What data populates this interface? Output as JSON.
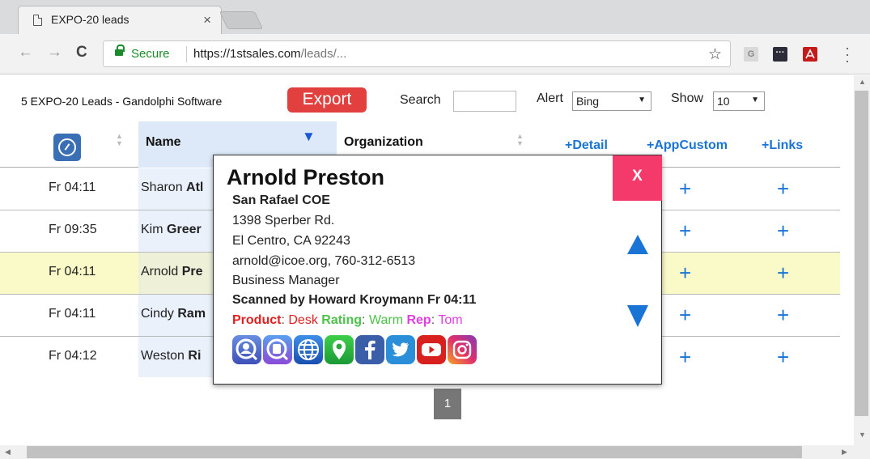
{
  "browser": {
    "tab_title": "EXPO-20 leads",
    "tab_close": "×",
    "secure_label": "Secure",
    "url_main": "https://1stsales.com",
    "url_rest": "/leads/...",
    "back": "←",
    "forward": "→",
    "reload": "C",
    "star": "☆",
    "ext_g": "G",
    "ext_dots": "···"
  },
  "header": {
    "title": "5 EXPO-20 Leads - Gandolphi Software",
    "export_label": "Export",
    "search_label": "Search",
    "alert_label": "Alert",
    "alert_value": "Bing",
    "show_label": "Show",
    "show_value": "10"
  },
  "table": {
    "columns": {
      "name": "Name",
      "organization": "Organization",
      "detail": "+Detail",
      "appcustom": "+AppCustom",
      "links": "+Links"
    },
    "rows": [
      {
        "time": "Fr 04:11",
        "first": "Sharon",
        "last": "Atl"
      },
      {
        "time": "Fr 09:35",
        "first": "Kim",
        "last": "Greer"
      },
      {
        "time": "Fr 04:11",
        "first": "Arnold",
        "last": "Pre"
      },
      {
        "time": "Fr 04:11",
        "first": "Cindy",
        "last": "Ram"
      },
      {
        "time": "Fr 04:12",
        "first": "Weston",
        "last": "Ri"
      }
    ],
    "plus": "+"
  },
  "pager": {
    "page": "1"
  },
  "popup": {
    "name": "Arnold Preston",
    "organization": "San Rafael COE",
    "street": "1398 Sperber Rd.",
    "city": "El Centro, CA 92243",
    "contact": "arnold@icoe.org, 760-312-6513",
    "role": "Business Manager",
    "scanned": "Scanned by Howard Kroymann Fr 04:11",
    "product_label": "Product",
    "product_value": "Desk",
    "rating_label": "Rating",
    "rating_value": "Warm",
    "rep_label": "Rep",
    "rep_value": "Tom",
    "close_label": "X",
    "colors": {
      "product": "#e0201e",
      "rating": "#4cc24a",
      "rep": "#e040e0"
    }
  }
}
